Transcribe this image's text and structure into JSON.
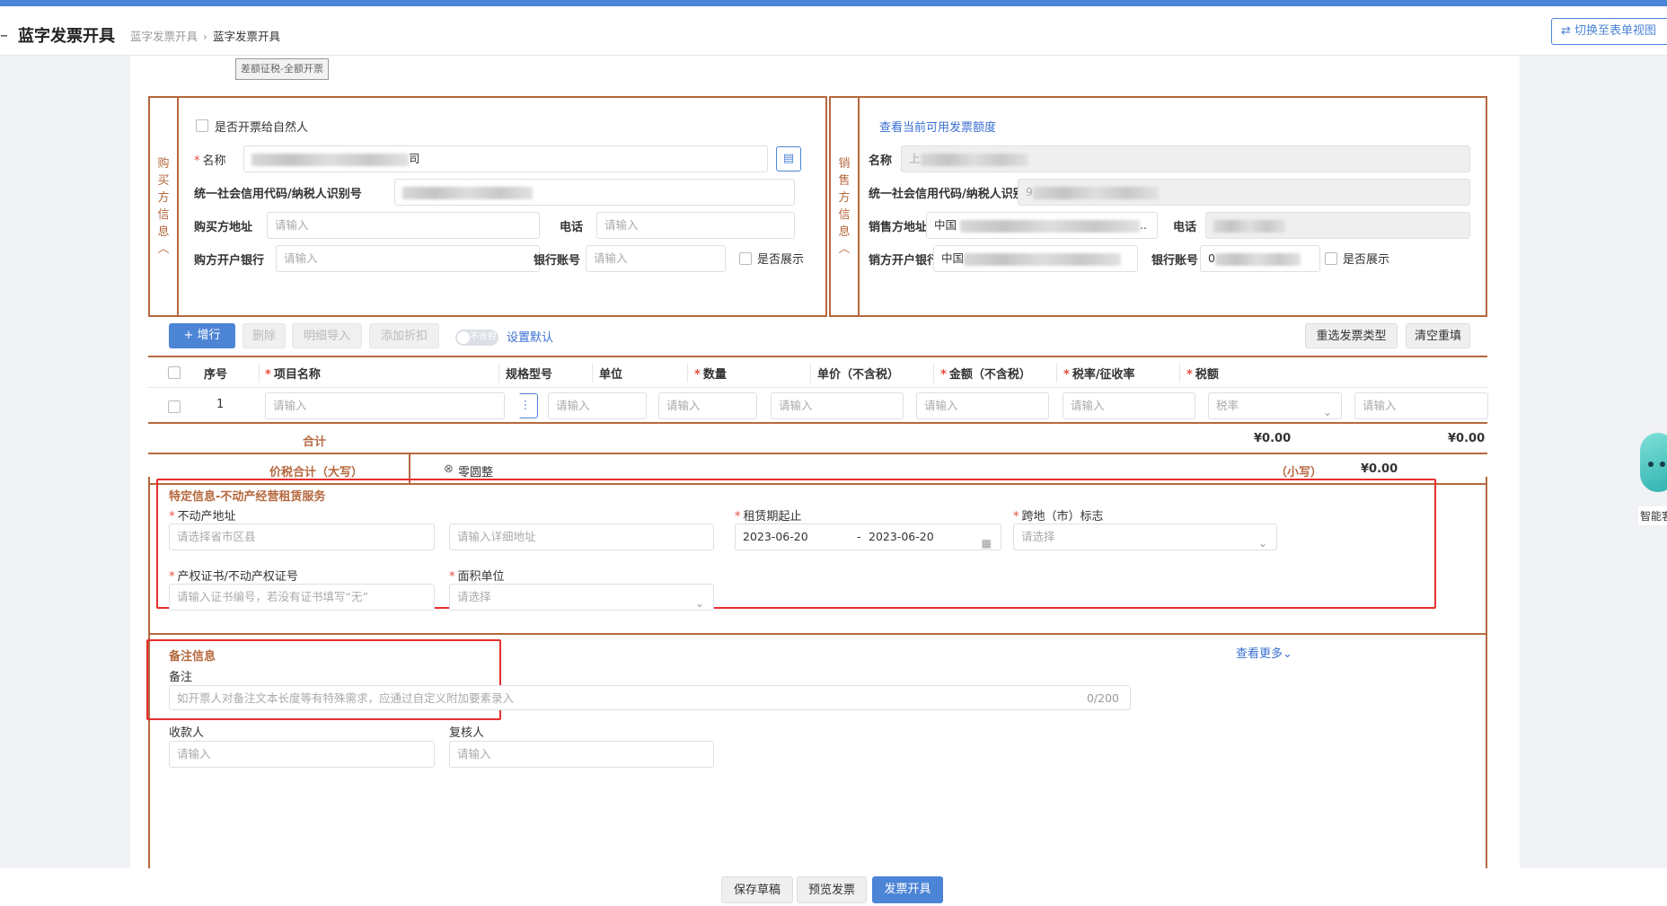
{
  "header": {
    "back_glyph": "–",
    "title": "蓝字发票开具",
    "breadcrumb": [
      "蓝字发票开具",
      "蓝字发票开具"
    ],
    "breadcrumb_sep": "›",
    "switch_view": "切换至表单视图"
  },
  "invoice_tag": "差额征税-全额开票",
  "buyer": {
    "section_label": [
      "购",
      "买",
      "方",
      "信",
      "息",
      "︿"
    ],
    "natural_person_label": "是否开票给自然人",
    "name_label": "名称",
    "name_value_suffix": "司",
    "tax_id_label": "统一社会信用代码/纳税人识别号",
    "address_label": "购买方地址",
    "address_placeholder": "请输入",
    "phone_label": "电话",
    "phone_placeholder": "请输入",
    "bank_label": "购方开户银行",
    "bank_placeholder": "请输入",
    "account_label": "银行账号",
    "account_placeholder": "请输入",
    "show_label": "是否展示"
  },
  "seller": {
    "section_label": [
      "销",
      "售",
      "方",
      "信",
      "息",
      "︿"
    ],
    "quota_link": "查看当前可用发票额度",
    "name_label": "名称",
    "name_value_prefix": "上",
    "tax_id_label": "统一社会信用代码/纳税人识别号",
    "tax_id_prefix": "9",
    "address_label": "销售方地址",
    "address_value_prefix": "中国",
    "address_value_suffix": "..",
    "phone_label": "电话",
    "bank_label": "销方开户银行",
    "bank_value_prefix": "中国",
    "account_label": "银行账号",
    "account_value_prefix": "0",
    "show_label": "是否展示"
  },
  "toolbar": {
    "add_row": "+ 增行",
    "delete": "删除",
    "detail_import": "明细导入",
    "add_discount": "添加折扣",
    "toggle_text": "不含税",
    "set_default": "设置默认",
    "reselect_type": "重选发票类型",
    "clear_refill": "清空重填"
  },
  "items_table": {
    "columns": [
      {
        "label": "序号",
        "required": false
      },
      {
        "label": "项目名称",
        "required": true
      },
      {
        "label": "规格型号",
        "required": false
      },
      {
        "label": "单位",
        "required": false
      },
      {
        "label": "数量",
        "required": true
      },
      {
        "label": "单价（不含税）",
        "required": false
      },
      {
        "label": "金额（不含税）",
        "required": true
      },
      {
        "label": "税率/征收率",
        "required": true
      },
      {
        "label": "税额",
        "required": true
      }
    ],
    "rows": [
      {
        "index": "1",
        "name_placeholder": "请输入",
        "spec_placeholder": "请输入",
        "unit_placeholder": "请输入",
        "qty_placeholder": "请输入",
        "price_placeholder": "请输入",
        "amount_placeholder": "请输入",
        "rate_placeholder": "税率",
        "tax_placeholder": "请输入"
      }
    ],
    "sum_label": "合计",
    "sum_amount": "¥0.00",
    "sum_tax": "¥0.00",
    "total_label": "价税合计（大写）",
    "total_upper": "零圆整",
    "total_small_label": "（小写）",
    "total_small": "¥0.00"
  },
  "special_info": {
    "title": "特定信息-不动产经营租赁服务",
    "property_address_label": "不动产地址",
    "region_placeholder": "请选择省市区县",
    "detail_placeholder": "请输入详细地址",
    "lease_period_label": "租赁期起止",
    "lease_start": "2023-06-20",
    "lease_sep": "-",
    "lease_end": "2023-06-20",
    "cross_city_label": "跨地（市）标志",
    "cross_city_placeholder": "请选择",
    "cert_label": "产权证书/不动产权证号",
    "cert_placeholder": "请输入证书编号，若没有证书填写“无”",
    "area_unit_label": "面积单位",
    "area_unit_placeholder": "请选择"
  },
  "remarks": {
    "title": "备注信息",
    "more_link": "查看更多",
    "remark_label": "备注",
    "remark_placeholder": "如开票人对备注文本长度等有特殊需求，应通过自定义附加要素录入",
    "remark_count": "0/200",
    "payee_label": "收款人",
    "payee_placeholder": "请输入",
    "reviewer_label": "复核人",
    "reviewer_placeholder": "请输入"
  },
  "footer": {
    "save_draft": "保存草稿",
    "preview": "预览发票",
    "issue": "发票开具"
  },
  "assistant_label": "智能客",
  "colors": {
    "accent": "#4c84d6",
    "section_border": "#b5683e",
    "highlight_frame": "#e62e2e",
    "required": "#e74c3c"
  }
}
